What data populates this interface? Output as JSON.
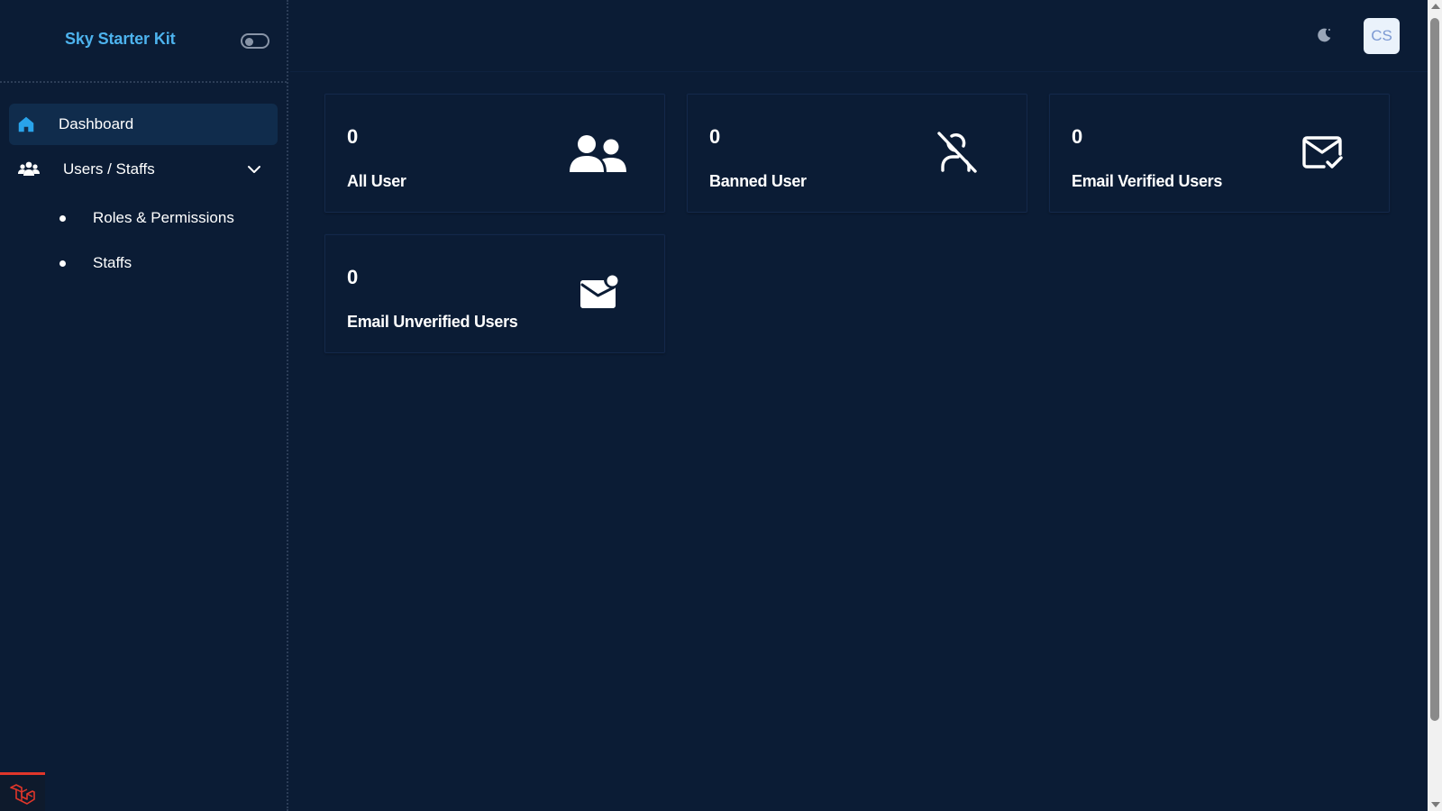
{
  "app": {
    "brand": "Sky Starter Kit"
  },
  "sidebar": {
    "items": [
      {
        "label": "Dashboard",
        "icon": "home-icon",
        "active": true
      },
      {
        "label": "Users / Staffs",
        "icon": "users-icon",
        "expanded": true,
        "children": [
          {
            "label": "Roles & Permissions"
          },
          {
            "label": "Staffs"
          }
        ]
      }
    ]
  },
  "header": {
    "theme_icon": "moon-icon",
    "avatar_initials": "CS"
  },
  "cards": [
    {
      "count": "0",
      "title": "All User",
      "icon": "users-group-icon"
    },
    {
      "count": "0",
      "title": "Banned User",
      "icon": "user-off-icon"
    },
    {
      "count": "0",
      "title": "Email Verified Users",
      "icon": "mail-check-icon"
    },
    {
      "count": "0",
      "title": "Email Unverified Users",
      "icon": "mail-notification-icon"
    }
  ],
  "colors": {
    "background": "#0b1c35",
    "brand": "#4db3ee",
    "active_nav": "#102c4c",
    "home_icon": "#29a3ea",
    "laravel_red": "#e0362a"
  }
}
